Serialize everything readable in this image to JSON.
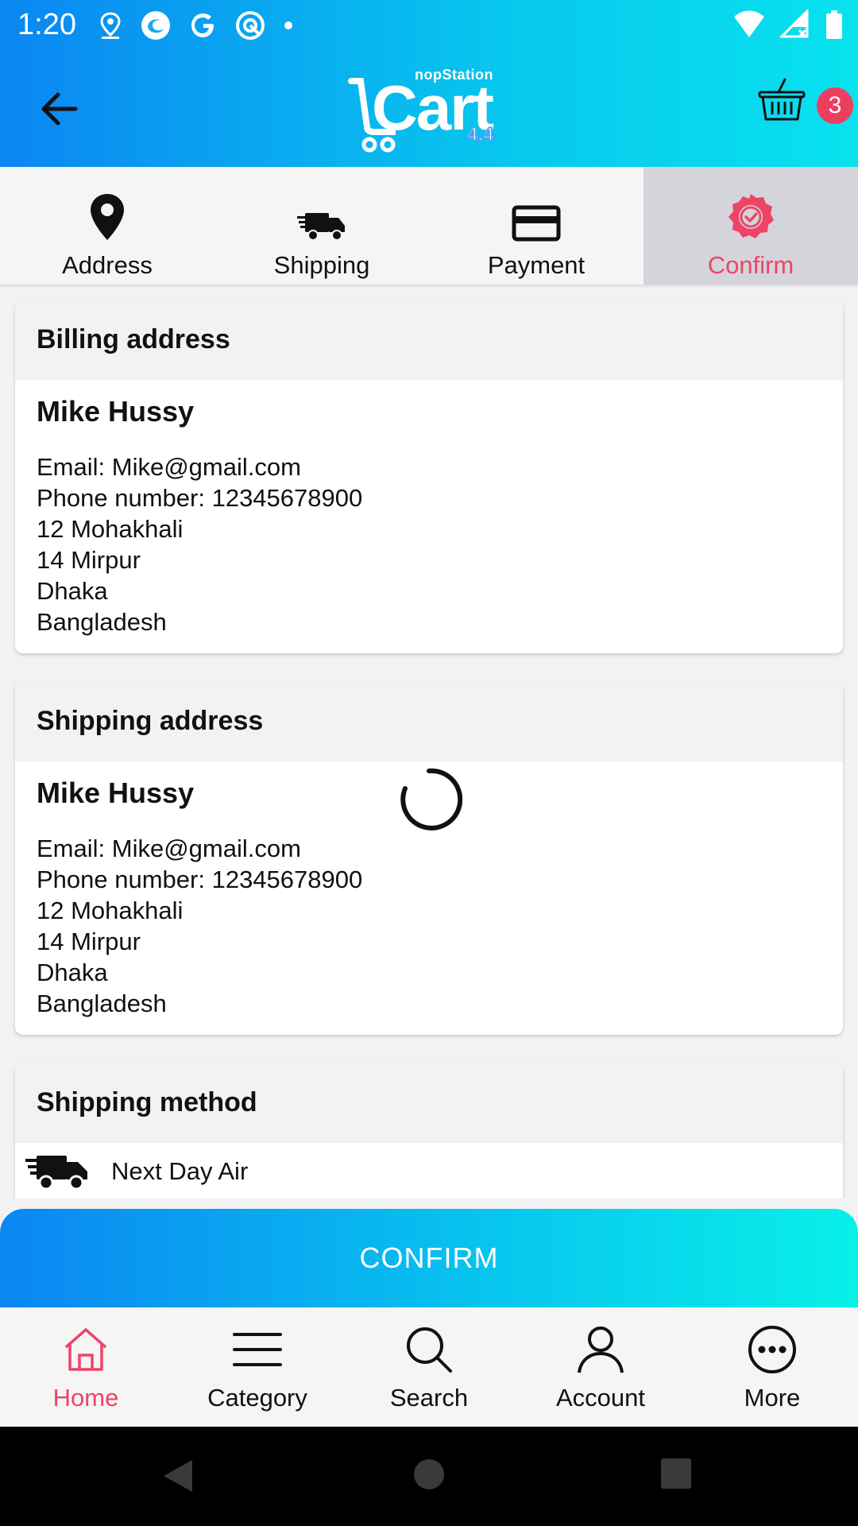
{
  "status_bar": {
    "time": "1:20",
    "left_icons": [
      "location-icon",
      "edge-browser-icon",
      "google-icon",
      "vpn-icon",
      "dot-icon"
    ],
    "right_icons": [
      "wifi-icon",
      "cellular-icon",
      "battery-icon"
    ]
  },
  "app_bar": {
    "logo_brand": "nopStation",
    "logo_text": "Cart",
    "logo_version": "4.4",
    "cart_count": "3"
  },
  "steps": [
    {
      "label": "Address",
      "icon": "location-pin-icon",
      "active": false
    },
    {
      "label": "Shipping",
      "icon": "truck-icon",
      "active": false
    },
    {
      "label": "Payment",
      "icon": "credit-card-icon",
      "active": false
    },
    {
      "label": "Confirm",
      "icon": "confirm-badge-icon",
      "active": true
    }
  ],
  "billing": {
    "title": "Billing address",
    "name": "Mike Hussy",
    "lines": [
      "Email: Mike@gmail.com",
      "Phone number: 12345678900",
      "12 Mohakhali",
      "14 Mirpur",
      "Dhaka",
      "Bangladesh"
    ]
  },
  "shipping": {
    "title": "Shipping address",
    "name": "Mike Hussy",
    "lines": [
      "Email: Mike@gmail.com",
      "Phone number: 12345678900",
      "12 Mohakhali",
      "14 Mirpur",
      "Dhaka",
      "Bangladesh"
    ]
  },
  "shipping_method": {
    "title": "Shipping method",
    "value": "Next Day Air"
  },
  "confirm_button": "CONFIRM",
  "bottom_nav": [
    {
      "label": "Home",
      "icon": "home-icon",
      "active": true
    },
    {
      "label": "Category",
      "icon": "menu-icon",
      "active": false
    },
    {
      "label": "Search",
      "icon": "search-icon",
      "active": false
    },
    {
      "label": "Account",
      "icon": "account-icon",
      "active": false
    },
    {
      "label": "More",
      "icon": "more-icon",
      "active": false
    }
  ],
  "colors": {
    "accent": "#ee4466",
    "gradient_start": "#0a86f2",
    "gradient_end": "#08e2ee"
  }
}
